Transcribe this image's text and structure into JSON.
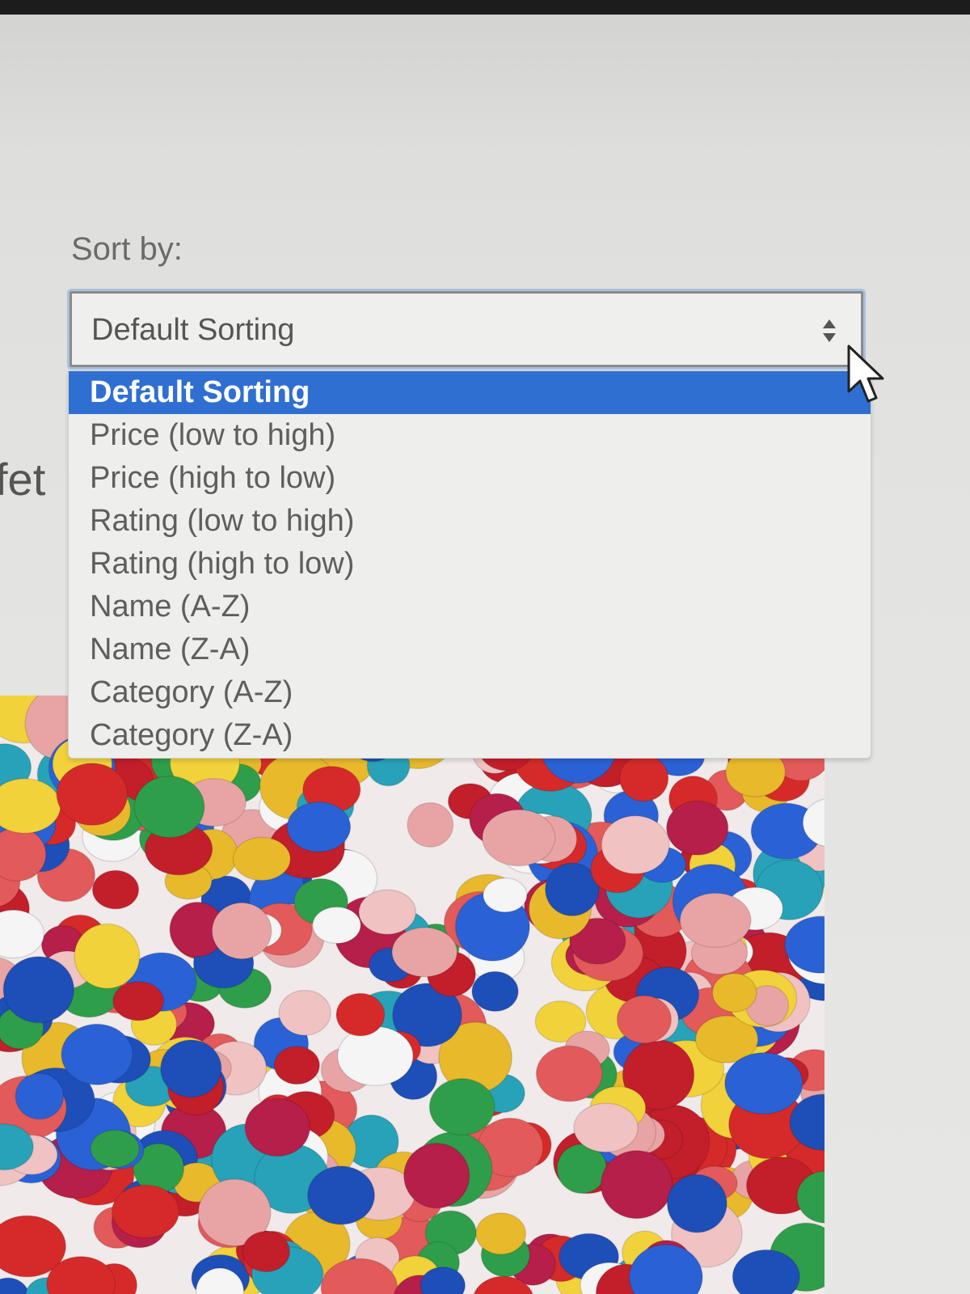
{
  "sort": {
    "label": "Sort by:",
    "selected_value": "Default Sorting",
    "options": [
      "Default Sorting",
      "Price (low to high)",
      "Price (high to low)",
      "Rating (low to high)",
      "Rating (high to low)",
      "Name (A-Z)",
      "Name (Z-A)",
      "Category (A-Z)",
      "Category (Z-A)"
    ],
    "highlighted_index": 0
  },
  "background": {
    "partial_heading": "fet"
  },
  "icons": {
    "select_arrows": "updown-arrows-icon",
    "cursor": "mouse-pointer-icon"
  },
  "colors": {
    "highlight": "#2f6fd1",
    "focus_ring": "#a9c2dc"
  }
}
